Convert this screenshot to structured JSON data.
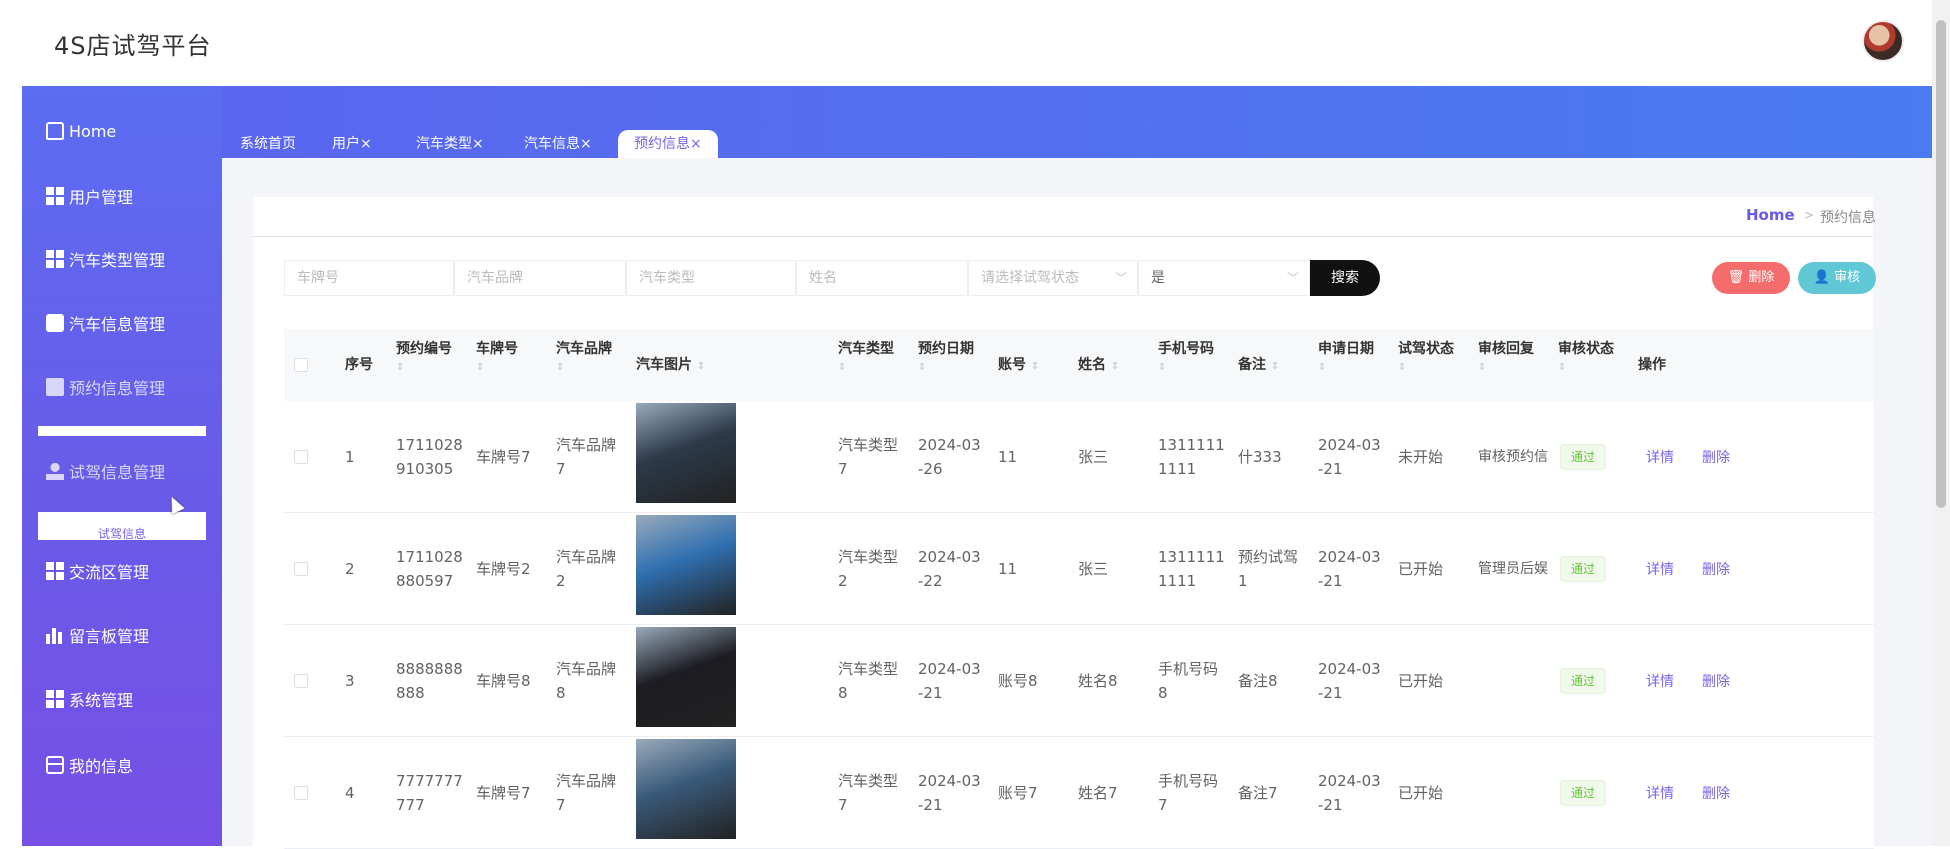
{
  "app": {
    "title": "4S店试驾平台"
  },
  "sidebar": {
    "items": [
      {
        "label": "Home",
        "icon": "home-icon"
      },
      {
        "label": "用户管理",
        "icon": "grid-icon"
      },
      {
        "label": "汽车类型管理",
        "icon": "grid-icon"
      },
      {
        "label": "汽车信息管理",
        "icon": "car-icon"
      },
      {
        "label": "预约信息管理",
        "icon": "briefcase-icon"
      },
      {
        "label": "试驾信息管理",
        "icon": "user-icon"
      },
      {
        "label": "交流区管理",
        "icon": "grid-icon"
      },
      {
        "label": "留言板管理",
        "icon": "bar-chart-icon"
      },
      {
        "label": "系统管理",
        "icon": "grid-icon"
      },
      {
        "label": "我的信息",
        "icon": "card-icon"
      }
    ],
    "submenu_popup": "试驾信息"
  },
  "tabs": [
    "系统首页",
    "用户×",
    "汽车类型×",
    "汽车信息×",
    "预约信息×"
  ],
  "active_tab": "预约信息×",
  "breadcrumb": {
    "home": "Home",
    "sep": ">",
    "current": "预约信息"
  },
  "filters": {
    "plate_placeholder": "车牌号",
    "brand_placeholder": "汽车品牌",
    "type_placeholder": "汽车类型",
    "name_placeholder": "姓名",
    "status_placeholder": "请选择试驾状态",
    "audit_value": "是"
  },
  "buttons": {
    "search": "搜索",
    "delete": "删除",
    "audit": "审核",
    "delete_icon": "trash-icon",
    "audit_icon": "user-icon"
  },
  "table": {
    "headers": [
      "序号",
      "预约编号",
      "车牌号",
      "汽车品牌",
      "汽车图片",
      "汽车类型",
      "预约日期",
      "账号",
      "姓名",
      "手机号码",
      "备注",
      "申请日期",
      "试驾状态",
      "审核回复",
      "审核状态",
      "操作"
    ],
    "rows": [
      {
        "idx": "1",
        "code": [
          "1711028",
          "910305"
        ],
        "plate": "车牌号7",
        "brand": [
          "汽车品牌",
          "7"
        ],
        "type": [
          "汽车类型",
          "7"
        ],
        "date": [
          "2024-03",
          "-26"
        ],
        "account": "11",
        "name": "张三",
        "phone": [
          "1311111",
          "1111"
        ],
        "note": [
          "什333",
          ""
        ],
        "apply": [
          "2024-03",
          "-21"
        ],
        "drive_status": "未开始",
        "reply": "审核预约信",
        "audit_status": "通过",
        "detail": "详情",
        "del": "删除",
        "color": "#2c3a4a"
      },
      {
        "idx": "2",
        "code": [
          "1711028",
          "880597"
        ],
        "plate": "车牌号2",
        "brand": [
          "汽车品牌",
          "2"
        ],
        "type": [
          "汽车类型",
          "2"
        ],
        "date": [
          "2024-03",
          "-22"
        ],
        "account": "11",
        "name": "张三",
        "phone": [
          "1311111",
          "1111"
        ],
        "note": [
          "预约试驾",
          "1"
        ],
        "apply": [
          "2024-03",
          "-21"
        ],
        "drive_status": "已开始",
        "reply": "管理员后娱",
        "audit_status": "通过",
        "detail": "详情",
        "del": "删除",
        "color": "#2f6fb0"
      },
      {
        "idx": "3",
        "code": [
          "8888888",
          "888"
        ],
        "plate": "车牌号8",
        "brand": [
          "汽车品牌",
          "8"
        ],
        "type": [
          "汽车类型",
          "8"
        ],
        "date": [
          "2024-03",
          "-21"
        ],
        "account": "账号8",
        "name": "姓名8",
        "phone": [
          "手机号码",
          "8"
        ],
        "note": [
          "备注8",
          ""
        ],
        "apply": [
          "2024-03",
          "-21"
        ],
        "drive_status": "已开始",
        "reply": "",
        "audit_status": "通过",
        "detail": "详情",
        "del": "删除",
        "color": "#1c1c22"
      },
      {
        "idx": "4",
        "code": [
          "7777777",
          "777"
        ],
        "plate": "车牌号7",
        "brand": [
          "汽车品牌",
          "7"
        ],
        "type": [
          "汽车类型",
          "7"
        ],
        "date": [
          "2024-03",
          "-21"
        ],
        "account": "账号7",
        "name": "姓名7",
        "phone": [
          "手机号码",
          "7"
        ],
        "note": [
          "备注7",
          ""
        ],
        "apply": [
          "2024-03",
          "-21"
        ],
        "drive_status": "已开始",
        "reply": "",
        "audit_status": "通过",
        "detail": "详情",
        "del": "删除",
        "color": "#3a5a7a"
      }
    ]
  },
  "colors": {
    "accent": "#7a63e8",
    "sidebar_top": "#5b6df2",
    "sidebar_bottom": "#7650e6",
    "danger": "#f56c6c",
    "info": "#5fc8d4",
    "success": "#67c23a"
  }
}
